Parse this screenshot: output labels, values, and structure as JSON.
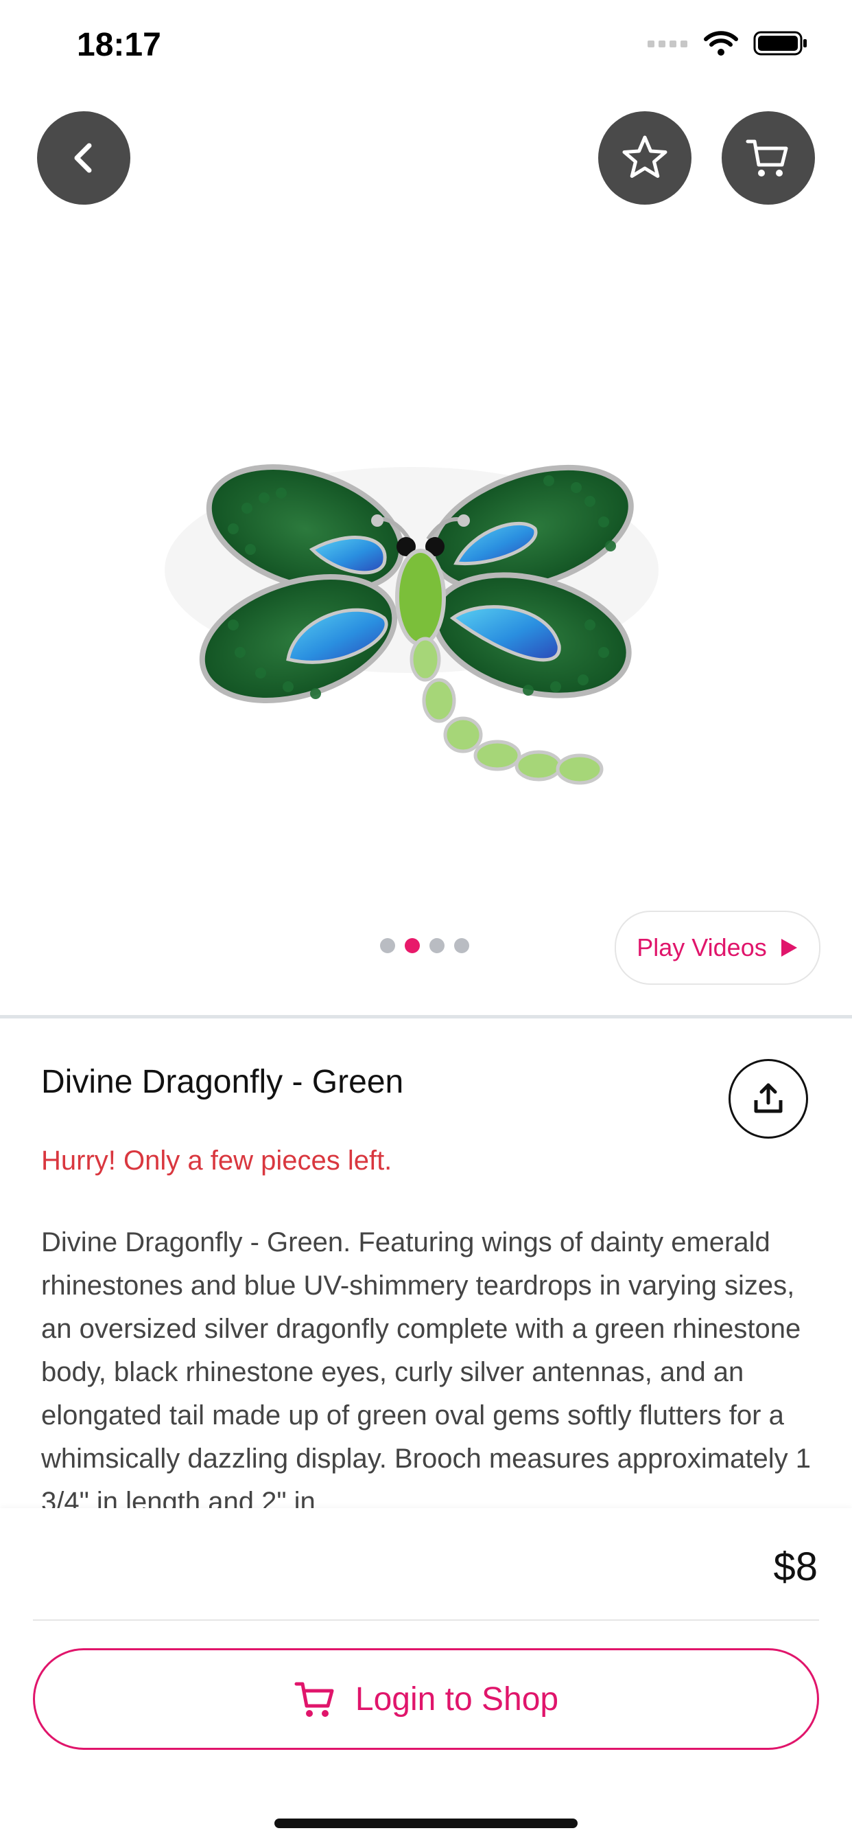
{
  "status_bar": {
    "time": "18:17"
  },
  "header": {
    "back_icon": "chevron-left-icon",
    "favorite_icon": "star-icon",
    "cart_icon": "cart-icon"
  },
  "gallery": {
    "image_alt": "dragonfly brooch with green and blue rhinestones",
    "page_count": 4,
    "active_page": 2,
    "play_videos_label": "Play Videos"
  },
  "product": {
    "title": "Divine Dragonfly - Green",
    "stock_warning": "Hurry! Only a few pieces left.",
    "description": "Divine Dragonfly - Green. Featuring wings of dainty emerald rhinestones and blue UV-shimmery teardrops in varying sizes, an oversized silver dragonfly complete with a green rhinestone body, black rhinestone eyes, curly silver antennas, and an elongated tail made up of green oval gems softly flutters for a whimsically dazzling display. Brooch measures approximately 1 3/4\" in length and 2\" in"
  },
  "purchase": {
    "price": "$8",
    "login_button_label": "Login to Shop"
  },
  "colors": {
    "accent": "#e0156b",
    "warning": "#d9373f",
    "header_button_bg": "#4a4a4a"
  }
}
